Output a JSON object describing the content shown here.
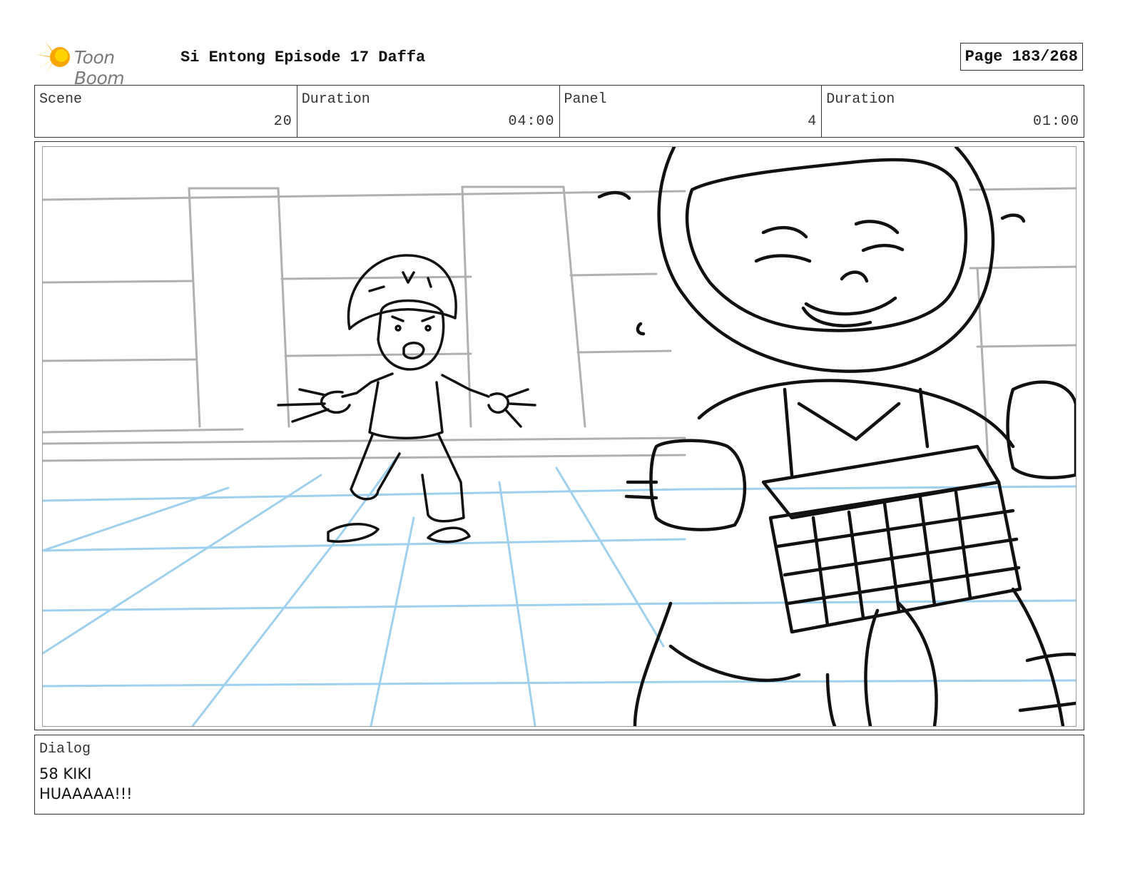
{
  "header": {
    "logo_text": "Toon Boom",
    "title": "Si Entong Episode 17 Daffa",
    "page": "Page 183/268"
  },
  "info": {
    "scene_label": "Scene",
    "scene_value": "20",
    "scene_duration_label": "Duration",
    "scene_duration_value": "04:00",
    "panel_label": "Panel",
    "panel_value": "4",
    "panel_duration_label": "Duration",
    "panel_duration_value": "01:00"
  },
  "dialog": {
    "label": "Dialog",
    "line1": "58 KIKI",
    "line2": "HUAAAAA!!!"
  },
  "colors": {
    "logo_orange": "#f7a600",
    "logo_yellow": "#ffd200",
    "sketch_ink": "#111111",
    "background_gray": "#b0b0b0",
    "floor_grid_blue": "#9fd0ee"
  }
}
